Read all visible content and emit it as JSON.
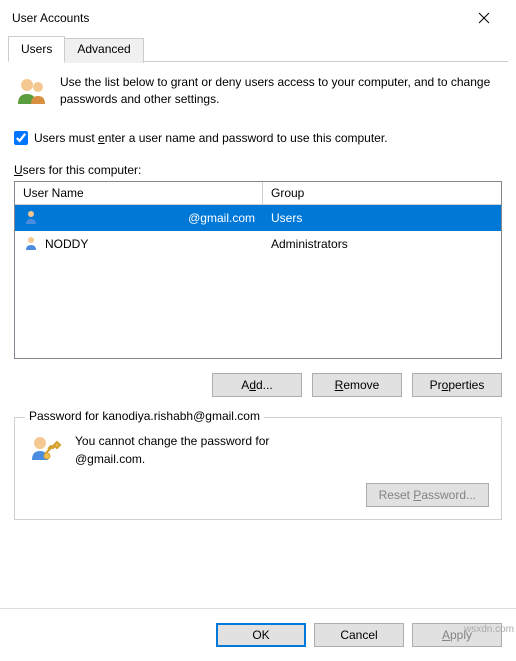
{
  "window": {
    "title": "User Accounts"
  },
  "tabs": {
    "users": "Users",
    "advanced": "Advanced"
  },
  "intro_text": "Use the list below to grant or deny users access to your computer, and to change passwords and other settings.",
  "checkbox_label": "Users must enter a user name and password to use this computer.",
  "checkbox_checked": true,
  "users_label": "Users for this computer:",
  "table": {
    "headers": {
      "name": "User Name",
      "group": "Group"
    },
    "rows": [
      {
        "name": "@gmail.com",
        "group": "Users",
        "selected": true
      },
      {
        "name": "NODDY",
        "group": "Administrators",
        "selected": false
      }
    ]
  },
  "buttons": {
    "add": "Add...",
    "remove": "Remove",
    "properties": "Properties"
  },
  "password_group": {
    "title": "Password for kanodiya.rishabh@gmail.com",
    "line1": "You cannot change the password for",
    "line2": "@gmail.com.",
    "reset": "Reset Password..."
  },
  "dialog_buttons": {
    "ok": "OK",
    "cancel": "Cancel",
    "apply": "Apply"
  },
  "watermark": "wsxdn.com"
}
